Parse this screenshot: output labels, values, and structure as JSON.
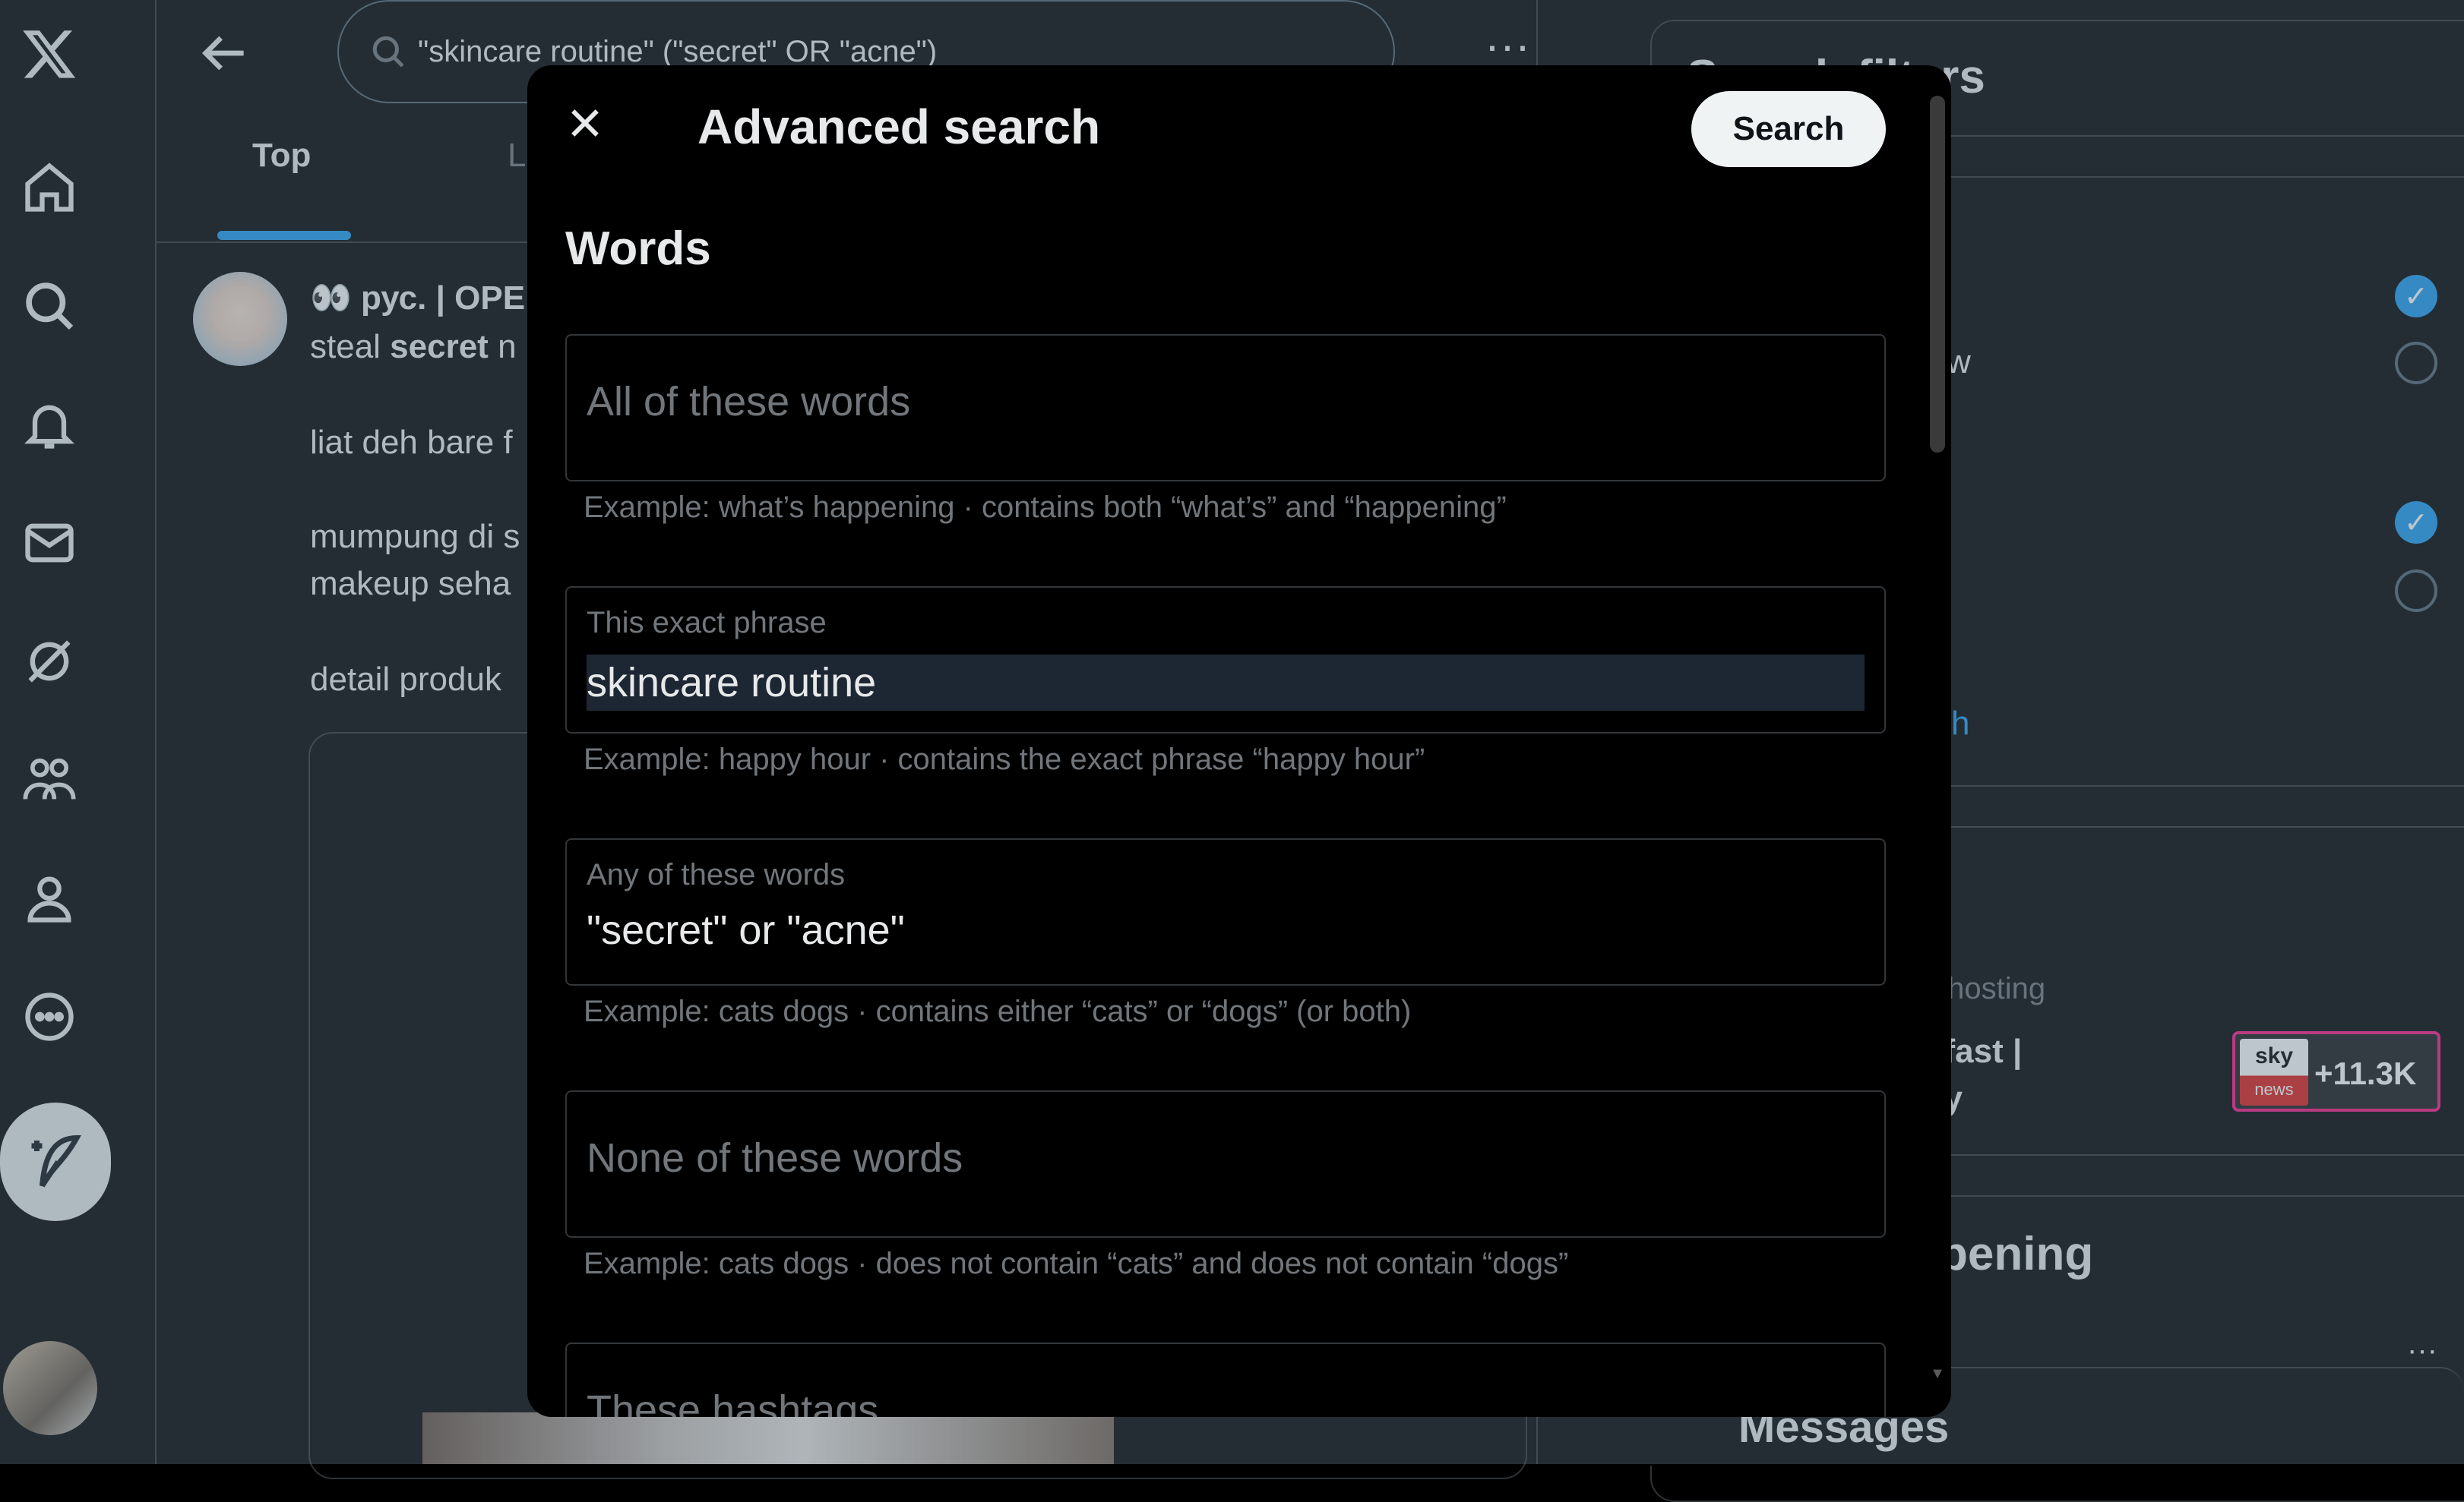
{
  "app": {
    "logo": "x-logo-icon"
  },
  "nav": {
    "items": [
      {
        "icon": "home-icon"
      },
      {
        "icon": "explore-icon"
      },
      {
        "icon": "bell-icon"
      },
      {
        "icon": "mail-icon"
      },
      {
        "icon": "grok-icon"
      },
      {
        "icon": "communities-icon"
      },
      {
        "icon": "profile-icon"
      },
      {
        "icon": "more-circle-icon"
      }
    ],
    "compose_icon": "compose-feather-icon"
  },
  "header": {
    "search_query": "\"skincare routine\" (\"secret\" OR \"acne\")",
    "more": "···"
  },
  "tabs": [
    {
      "label": "Top"
    },
    {
      "label": "L"
    }
  ],
  "tweet": {
    "author": "👀 рус. | OPE",
    "line1_a": "steal ",
    "line1_b": "secret",
    "line1_c": " n",
    "line2": "liat deh bare f",
    "line3": "mumpung di s",
    "line4": "makeup seha",
    "line5": "detail produk"
  },
  "right": {
    "filters_title": "Search filters",
    "row_w": "w",
    "advanced_link": "h",
    "live_host": "s hosting",
    "live_title_1": "kfast |",
    "live_title_2": "ay",
    "live_count": "+11.3K",
    "sky_top": "sky",
    "sky_bottom": "news",
    "happening_title": "pening",
    "messages_title": "Messages",
    "more_dots": "···"
  },
  "modal": {
    "title": "Advanced search",
    "search_label": "Search",
    "section_words": "Words",
    "fields": [
      {
        "placeholder": "All of these words",
        "hint": "Example: what’s happening · contains both “what’s” and “happening”"
      },
      {
        "label": "This exact phrase",
        "value": "skincare routine",
        "hint": "Example: happy hour · contains the exact phrase “happy hour”"
      },
      {
        "label": "Any of these words",
        "value": "\"secret\" or \"acne\"",
        "hint": "Example: cats dogs · contains either “cats” or “dogs” (or both)"
      },
      {
        "placeholder": "None of these words",
        "hint": "Example: cats dogs · does not contain “cats” and does not contain “dogs”"
      },
      {
        "placeholder": "These hashtags"
      }
    ]
  }
}
